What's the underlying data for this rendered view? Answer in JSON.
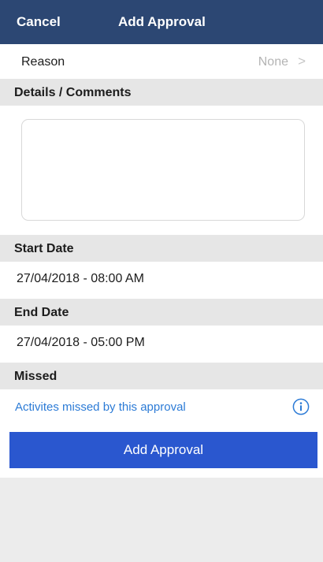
{
  "nav": {
    "cancel_label": "Cancel",
    "title": "Add Approval"
  },
  "reason": {
    "label": "Reason",
    "value": "None",
    "chevron": ">"
  },
  "details": {
    "header": "Details / Comments",
    "comment_value": ""
  },
  "start_date": {
    "header": "Start Date",
    "value": "27/04/2018 - 08:00 AM"
  },
  "end_date": {
    "header": "End Date",
    "value": "27/04/2018 - 05:00 PM"
  },
  "missed": {
    "header": "Missed",
    "link_text": "Activites missed by this approval",
    "icon": "info-icon"
  },
  "actions": {
    "add_label": "Add Approval"
  },
  "colors": {
    "nav_bar": "#2c4773",
    "section_header": "#e6e6e6",
    "link": "#2c7bd6",
    "primary_button": "#2a57cf"
  }
}
